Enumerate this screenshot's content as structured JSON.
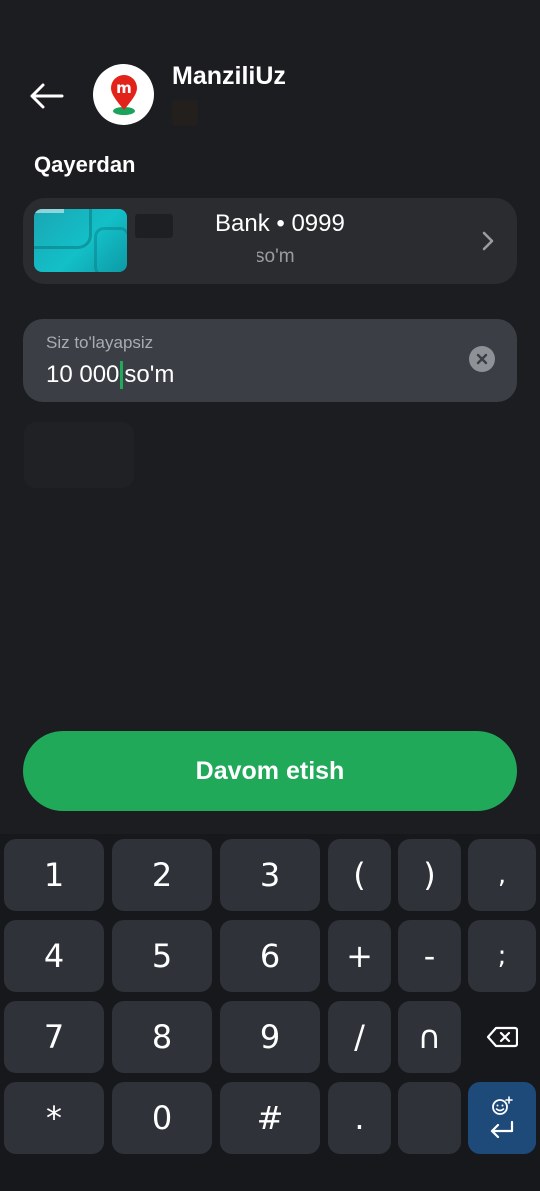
{
  "header": {
    "merchant_name": "ManziliUz",
    "logo_letter": "m"
  },
  "from_section": {
    "label": "Qayerdan",
    "card": {
      "name": "Bank • 0999",
      "balance": "so'm"
    }
  },
  "amount": {
    "label": "Siz to'layapsiz",
    "value": "10 000",
    "currency": "so'm"
  },
  "actions": {
    "continue_label": "Davom etish"
  },
  "keyboard": {
    "rows": [
      [
        "1",
        "2",
        "3",
        "(",
        ")",
        ","
      ],
      [
        "4",
        "5",
        "6",
        "+",
        "-",
        ";"
      ],
      [
        "7",
        "8",
        "9",
        "/",
        "∩",
        "backspace"
      ],
      [
        "*",
        "0",
        "#",
        ".",
        "",
        "enter"
      ]
    ]
  },
  "colors": {
    "background": "#1c1d21",
    "accent_green": "#21a95a",
    "field_bg": "#3b3e44",
    "card_bg": "#2a2c30",
    "key_bg": "#2f3238",
    "enter_key_bg": "#1e4a7a"
  }
}
